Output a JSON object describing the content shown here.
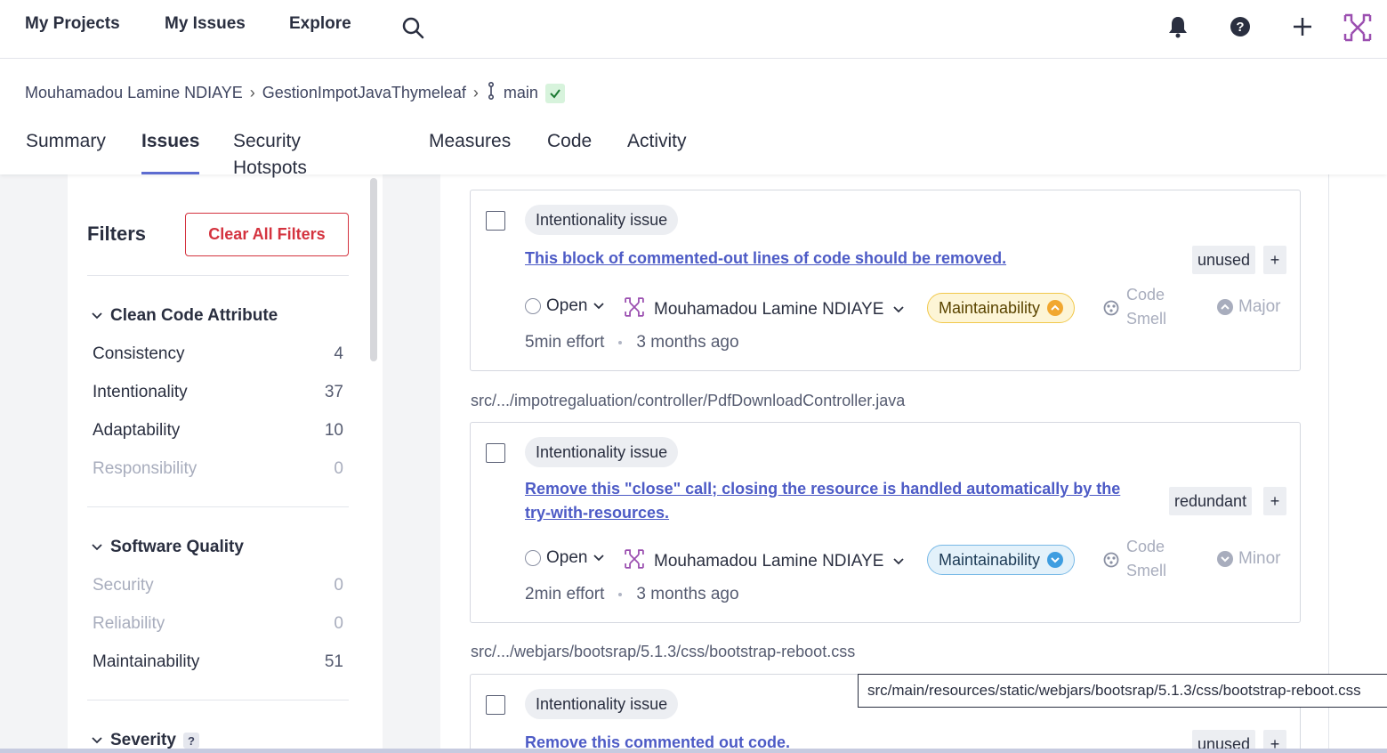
{
  "topnav": {
    "links": [
      "My Projects",
      "My Issues",
      "Explore"
    ]
  },
  "breadcrumb": {
    "owner": "Mouhamadou Lamine NDIAYE",
    "project": "GestionImpotJavaThymeleaf",
    "branch": "main"
  },
  "tabs": [
    "Summary",
    "Issues",
    "Security Hotspots",
    "Measures",
    "Code",
    "Activity"
  ],
  "active_tab": "Issues",
  "filters": {
    "title": "Filters",
    "clear_label": "Clear All Filters",
    "clean_code": {
      "title": "Clean Code Attribute",
      "items": [
        {
          "label": "Consistency",
          "count": "4"
        },
        {
          "label": "Intentionality",
          "count": "37"
        },
        {
          "label": "Adaptability",
          "count": "10"
        },
        {
          "label": "Responsibility",
          "count": "0"
        }
      ]
    },
    "software_quality": {
      "title": "Software Quality",
      "items": [
        {
          "label": "Security",
          "count": "0"
        },
        {
          "label": "Reliability",
          "count": "0"
        },
        {
          "label": "Maintainability",
          "count": "51"
        }
      ]
    },
    "severity": {
      "title": "Severity",
      "help": "?"
    }
  },
  "issues": [
    {
      "category": "Intentionality issue",
      "message": "This block of commented-out lines of code should be removed.",
      "tag": "unused",
      "status": "Open",
      "assignee": "Mouhamadou Lamine NDIAYE",
      "quality": "Maintainability",
      "type_line1": "Code",
      "type_line2": "Smell",
      "severity": "Major",
      "effort": "5min effort",
      "age": "3 months ago"
    },
    {
      "file": "src/.../impotregaluation/controller/PdfDownloadController.java",
      "category": "Intentionality issue",
      "message_line1": "Remove this \"close\" call; closing the resource is handled automatically by the",
      "message_line2": "try-with-resources.",
      "tag": "redundant",
      "status": "Open",
      "assignee": "Mouhamadou Lamine NDIAYE",
      "quality": "Maintainability",
      "type_line1": "Code",
      "type_line2": "Smell",
      "severity": "Minor",
      "effort": "2min effort",
      "age": "3 months ago"
    },
    {
      "file": "src/.../webjars/bootsrap/5.1.3/css/bootstrap-reboot.css",
      "category": "Intentionality issue",
      "message": "Remove this commented out code.",
      "tag": "unused"
    }
  ],
  "tooltip": "src/main/resources/static/webjars/bootsrap/5.1.3/css/bootstrap-reboot.css",
  "add_tag": "+",
  "colors": {
    "accent": "#5d6cd0",
    "link": "#4d5bc6",
    "danger": "#d4333f",
    "high_impact": "#f1a72f",
    "low_impact": "#3e9de0"
  }
}
